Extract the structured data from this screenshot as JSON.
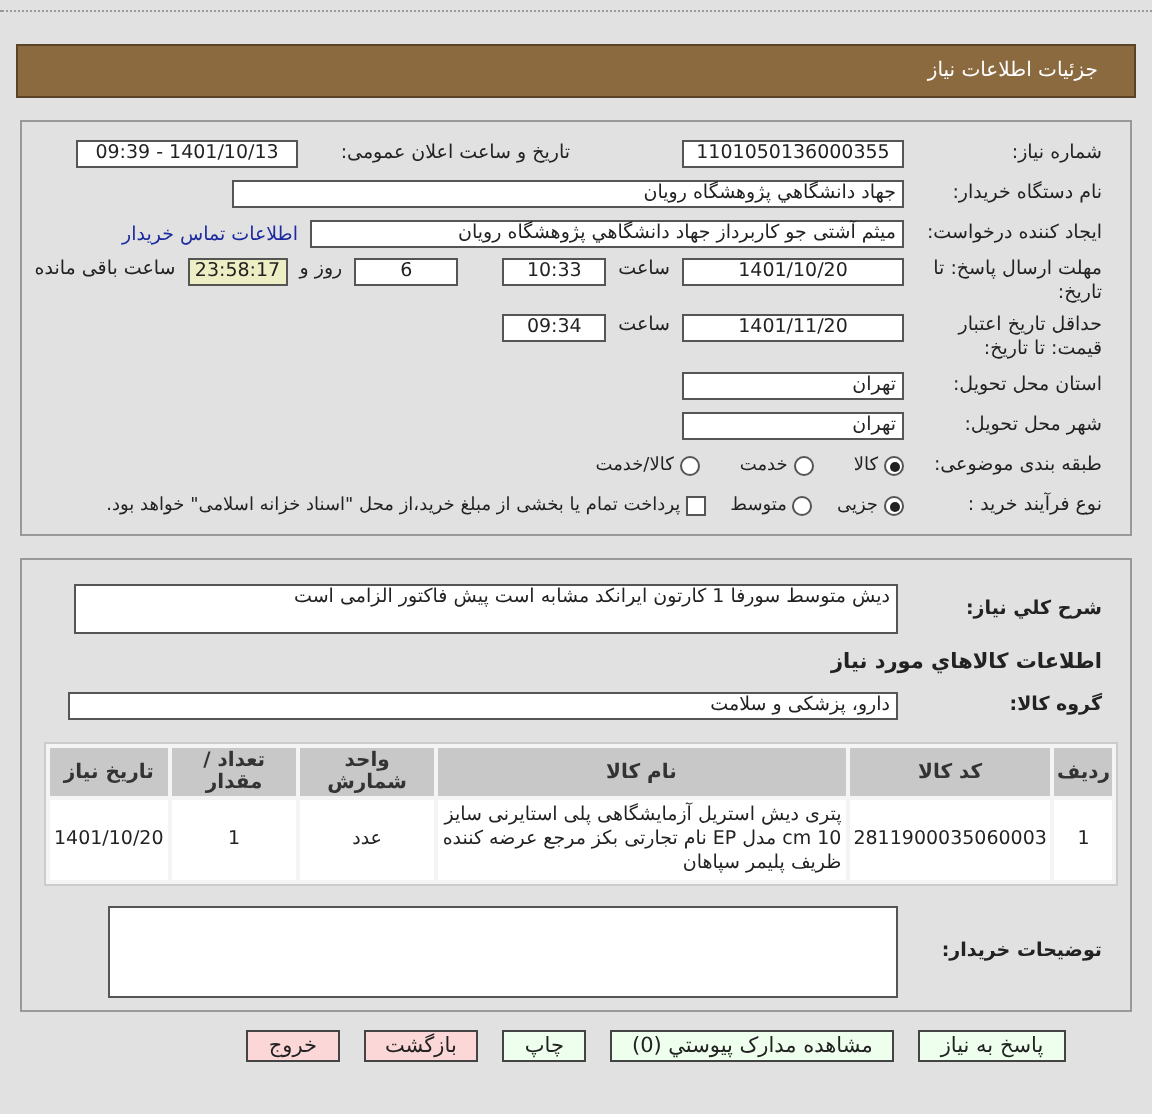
{
  "header": {
    "title": "جزئیات اطلاعات نیاز"
  },
  "need_number": {
    "label": "شماره نیاز:",
    "value": "1101050136000355"
  },
  "announce": {
    "label": "تاریخ و ساعت اعلان عمومی:",
    "value": "1401/10/13 - 09:39"
  },
  "buyer": {
    "label": "نام دستگاه خریدار:",
    "value": "جهاد دانشگاهي پژوهشگاه رويان"
  },
  "requester": {
    "label": "ایجاد کننده درخواست:",
    "value": "میثم  آشتی جو کاربرداز جهاد دانشگاهي پژوهشگاه رويان",
    "link": "اطلاعات تماس خریدار"
  },
  "deadline": {
    "label": "مهلت ارسال پاسخ: تا تاریخ:",
    "date": "1401/10/20",
    "time_label": "ساعت",
    "time": "10:33",
    "days": "6",
    "days_label": "روز و",
    "remaining": "23:58:17",
    "remaining_label": "ساعت باقی مانده"
  },
  "validity": {
    "label": "حداقل تاریخ اعتبار قیمت: تا تاریخ:",
    "date": "1401/11/20",
    "time_label": "ساعت",
    "time": "09:34"
  },
  "province": {
    "label": "استان محل تحویل:",
    "value": "تهران"
  },
  "city": {
    "label": "شهر محل تحویل:",
    "value": "تهران"
  },
  "category": {
    "label": "طبقه بندی موضوعی:",
    "options": [
      {
        "label": "کالا",
        "selected": true
      },
      {
        "label": "خدمت",
        "selected": false
      },
      {
        "label": "کالا/خدمت",
        "selected": false
      }
    ]
  },
  "process": {
    "label": "نوع فرآیند خرید :",
    "options": [
      {
        "label": "جزیی",
        "selected": true
      },
      {
        "label": "متوسط",
        "selected": false
      }
    ],
    "treasury": {
      "label": "پرداخت تمام یا بخشی از مبلغ خرید،از محل \"اسناد خزانه اسلامی\" خواهد بود.",
      "checked": false
    }
  },
  "description": {
    "label": "شرح کلي نياز:",
    "value": "دیش متوسط سورفا 1 کارتون ایرانکد مشابه است پیش فاکتور الزامی است"
  },
  "goods_title": "اطلاعات کالاهاي مورد نياز",
  "goods_group": {
    "label": "گروه کالا:",
    "value": "دارو، پزشکی و سلامت"
  },
  "table": {
    "columns": [
      "رديف",
      "کد کالا",
      "نام کالا",
      "واحد شمارش",
      "تعداد / مقدار",
      "تاریخ نیاز"
    ],
    "rows": [
      [
        "1",
        "2811900035060003",
        "پتری دیش استریل آزمایشگاهی پلی استایرنی سایز cm 10 مدل EP نام تجارتی بکز مرجع عرضه کننده ظریف پلیمر سپاهان",
        "عدد",
        "1",
        "1401/10/20"
      ]
    ]
  },
  "notes": {
    "label": "توضیحات خریدار:"
  },
  "buttons": [
    {
      "label": "پاسخ به نیاز",
      "kind": "go"
    },
    {
      "label": "مشاهده مدارک پیوستي (0)",
      "kind": "go"
    },
    {
      "label": "چاپ",
      "kind": "go"
    },
    {
      "label": "بازگشت",
      "kind": "stop"
    },
    {
      "label": "خروج",
      "kind": "stop"
    }
  ]
}
